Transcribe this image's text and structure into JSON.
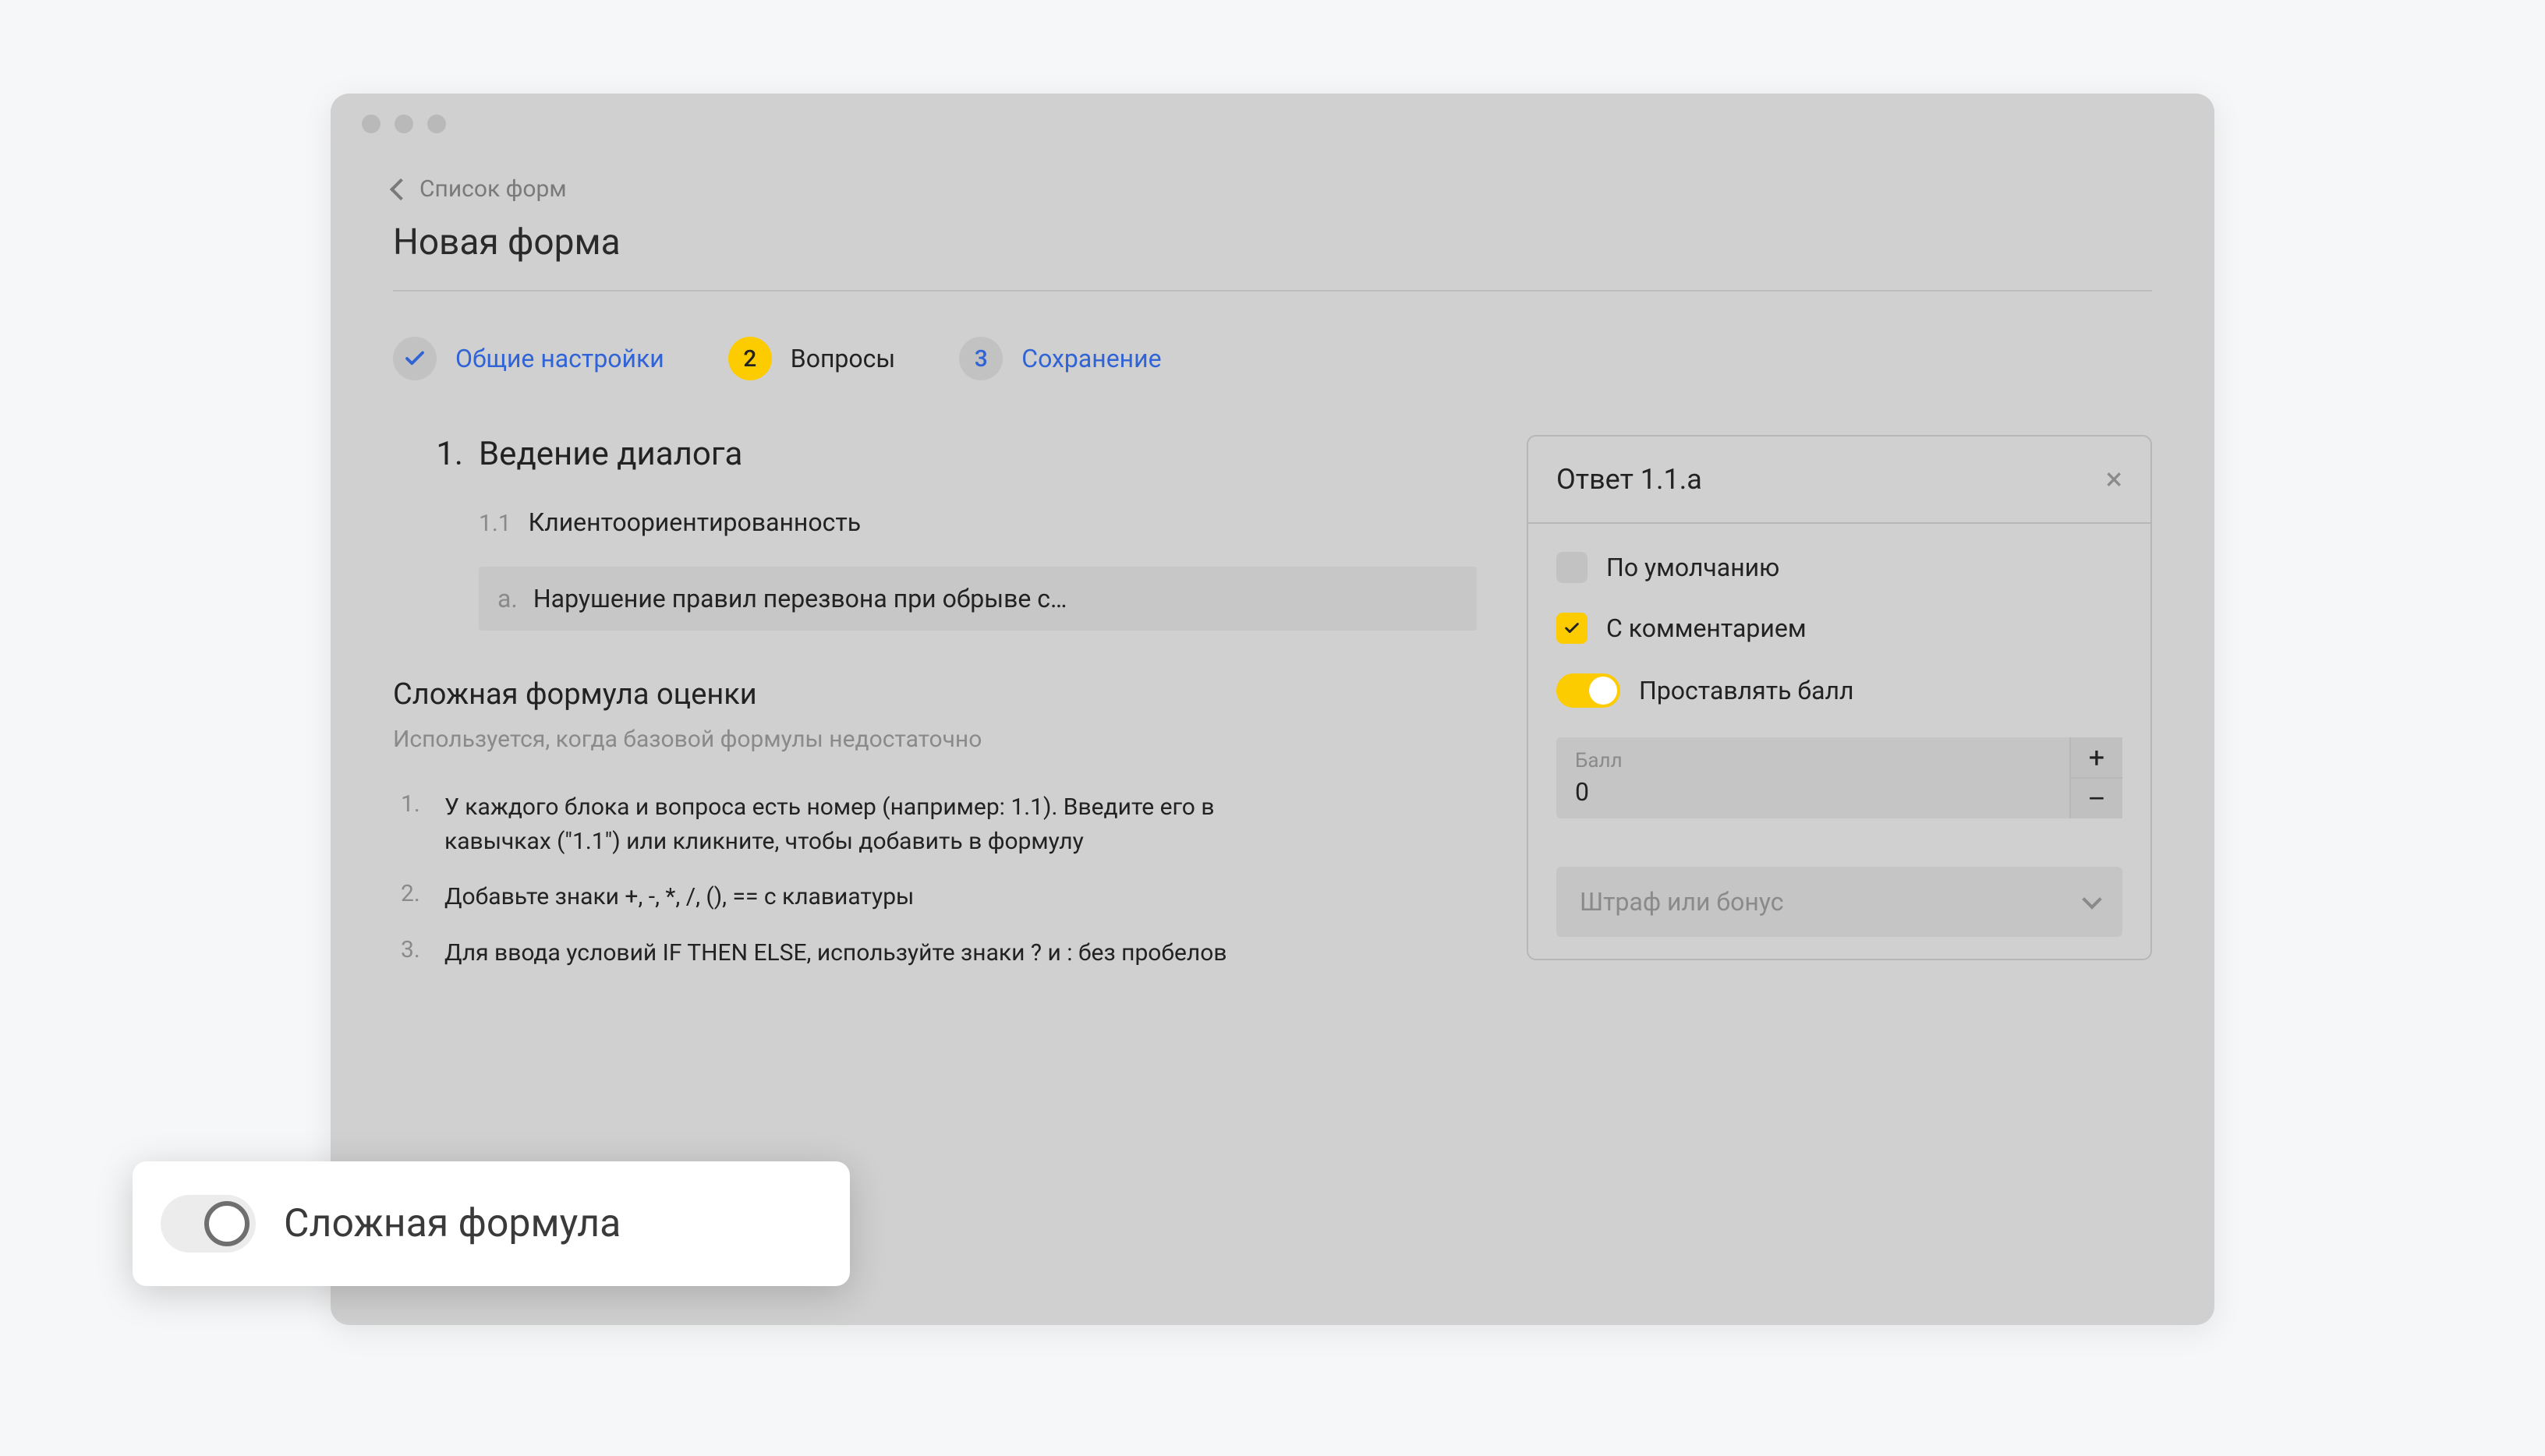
{
  "breadcrumb": {
    "label": "Список форм"
  },
  "page": {
    "title": "Новая форма"
  },
  "steps": {
    "s1": {
      "label": "Общие настройки"
    },
    "s2": {
      "num": "2",
      "label": "Вопросы"
    },
    "s3": {
      "num": "3",
      "label": "Сохранение"
    }
  },
  "section": {
    "num": "1.",
    "title": "Ведение диалога",
    "sub_num": "1.1",
    "sub_title": "Клиентоориентированность",
    "answer_letter": "a.",
    "answer_text": "Нарушение правил перезвона при обрыве с…"
  },
  "formula": {
    "heading": "Сложная формула оценки",
    "sub": "Используется, когда базовой формулы недостаточно",
    "items": [
      {
        "idx": "1.",
        "txt": "У каждого блока и вопроса есть номер (например: 1.1). Введите его в кавычках (\"1.1\") или кликните, чтобы добавить в формулу"
      },
      {
        "idx": "2.",
        "txt": "Добавьте знаки +, -, *, /, (), == с клавиатуры"
      },
      {
        "idx": "3.",
        "txt": "Для ввода условий IF THEN ELSE, используйте знаки ? и : без пробелов"
      }
    ]
  },
  "answer_panel": {
    "title": "Ответ 1.1.a",
    "opt_default": "По умолчанию",
    "opt_comment": "С комментарием",
    "opt_score_toggle": "Проставлять балл",
    "score_label": "Балл",
    "score_value": "0",
    "penalty_select": "Штраф или бонус"
  },
  "callout": {
    "label": "Сложная формула"
  }
}
